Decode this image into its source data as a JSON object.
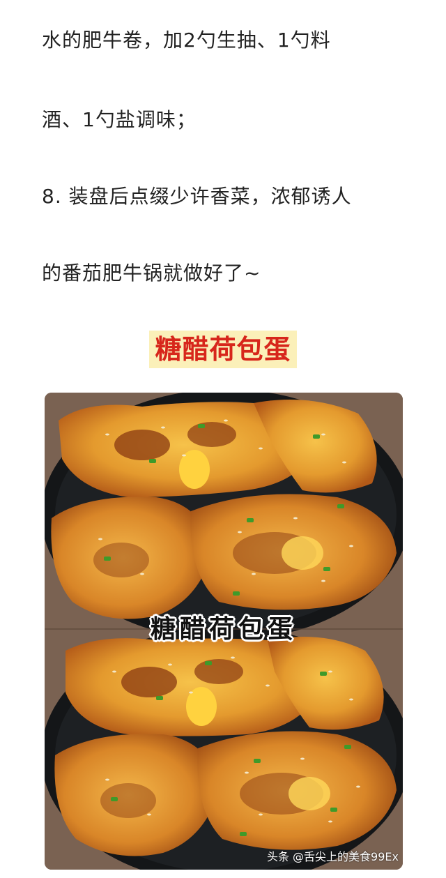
{
  "article": {
    "lines": [
      "水的肥牛卷，加2勺生抽、1勺料",
      "酒、1勺盐调味；",
      "8. 装盘后点缀少许香菜，浓郁诱人",
      "的番茄肥牛锅就做好了~"
    ],
    "section_heading": "糖醋荷包蛋"
  },
  "photo": {
    "caption": "糖醋荷包蛋",
    "watermark": "头条 @舌尖上的美食99Ex"
  }
}
